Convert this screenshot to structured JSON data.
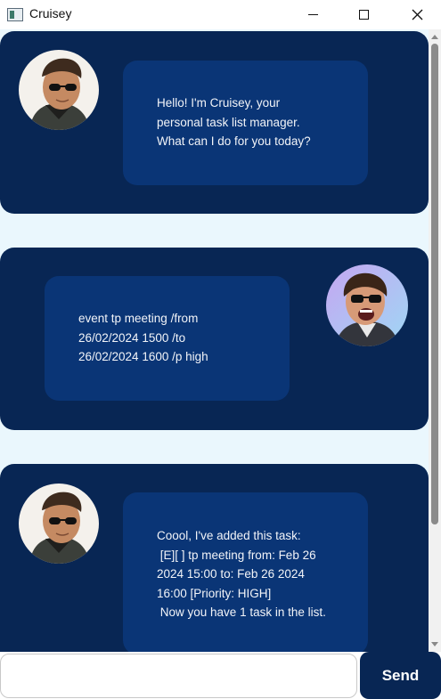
{
  "window": {
    "title": "Cruisey"
  },
  "messages": [
    {
      "sender": "bot",
      "text": "Hello! I'm Cruisey, your\npersonal task list manager.\nWhat can I do for you today?"
    },
    {
      "sender": "user",
      "text": "event tp meeting /from\n26/02/2024 1500 /to\n26/02/2024 1600 /p high"
    },
    {
      "sender": "bot",
      "text": "Coool, I've added this task:\n [E][ ] tp meeting from: Feb 26\n2024 15:00 to: Feb 26 2024\n16:00 [Priority: HIGH]\n Now you have 1 task in the list."
    }
  ],
  "input": {
    "value": "",
    "placeholder": ""
  },
  "send": {
    "label": "Send"
  },
  "colors": {
    "dialog": "#082654",
    "bubble": "#0a3576",
    "chat_bg": "#eaf7fd"
  }
}
